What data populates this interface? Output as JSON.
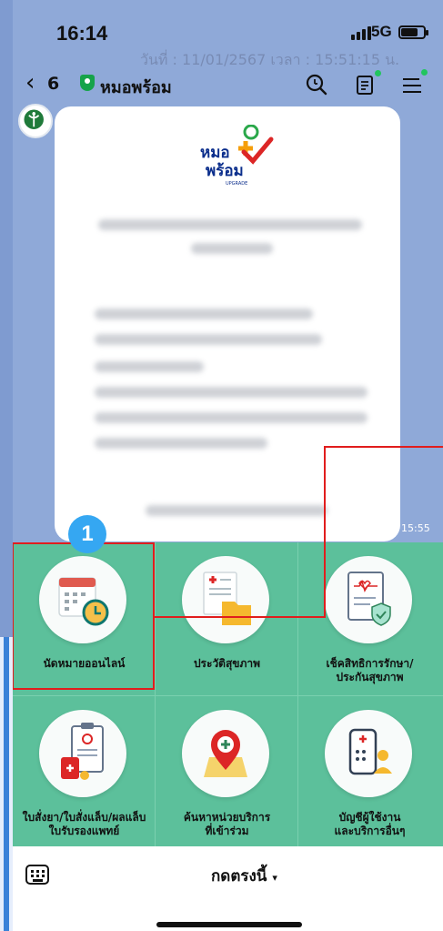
{
  "status": {
    "time": "16:14",
    "network": "5G"
  },
  "ghost_date": "วันที่ : 11/01/2567  เวลา : 15:51:15 น.",
  "header": {
    "back_icon": "chevron-left-icon",
    "unread_count": "6",
    "title": "หมอพร้อม",
    "icons": [
      "search-icon",
      "notes-icon",
      "menu-icon"
    ],
    "dot_color": "#22c55e"
  },
  "bubble": {
    "logo_text_top": "หมอ",
    "logo_text_bottom": "พร้อม",
    "logo_sub": "UPGRADE",
    "time": "15:55"
  },
  "step_badge": "1",
  "rich_menu": {
    "background": "#5cc09b",
    "items": [
      {
        "label": "นัดหมายออนไลน์",
        "icon": "calendar-clock-icon"
      },
      {
        "label": "ประวัติสุขภาพ",
        "icon": "medical-folder-icon"
      },
      {
        "label": "เช็คสิทธิการรักษา/\nประกันสุขภาพ",
        "icon": "insurance-document-icon"
      },
      {
        "label": "ใบสั่งยา/ใบสั่งแล็บ/ผลแล็บ\nใบรับรองแพทย์",
        "icon": "prescription-clipboard-icon"
      },
      {
        "label": "ค้นหาหน่วยบริการ\nที่เข้าร่วม",
        "icon": "map-location-icon"
      },
      {
        "label": "บัญชีผู้ใช้งาน\nและบริการอื่นๆ",
        "icon": "user-account-icon"
      }
    ]
  },
  "bottom_bar": {
    "keyboard_icon": "keyboard-icon",
    "tap_label": "กดตรงนี้",
    "caret": "▾"
  },
  "highlight_color": "#e11d1d"
}
